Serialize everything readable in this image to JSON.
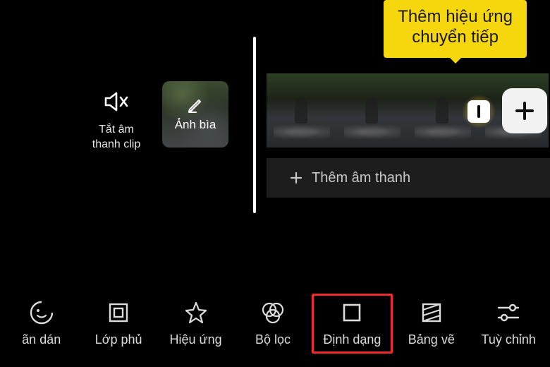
{
  "tooltip": {
    "line1": "Thêm hiệu ứng",
    "line2": "chuyển tiếp"
  },
  "mute_clip": {
    "label_line1": "Tắt âm",
    "label_line2": "thanh clip"
  },
  "cover": {
    "label": "Ảnh bìa"
  },
  "audio_track": {
    "label": "Thêm âm thanh"
  },
  "toolbar": [
    {
      "key": "sticker",
      "label": "ãn dán",
      "highlight": false
    },
    {
      "key": "overlay",
      "label": "Lớp phủ",
      "highlight": false
    },
    {
      "key": "effect",
      "label": "Hiệu ứng",
      "highlight": false
    },
    {
      "key": "filter",
      "label": "Bộ lọc",
      "highlight": false
    },
    {
      "key": "format",
      "label": "Định dạng",
      "highlight": true
    },
    {
      "key": "canvas",
      "label": "Bảng vẽ",
      "highlight": false
    },
    {
      "key": "adjust",
      "label": "Tuỳ chỉnh",
      "highlight": false
    }
  ]
}
